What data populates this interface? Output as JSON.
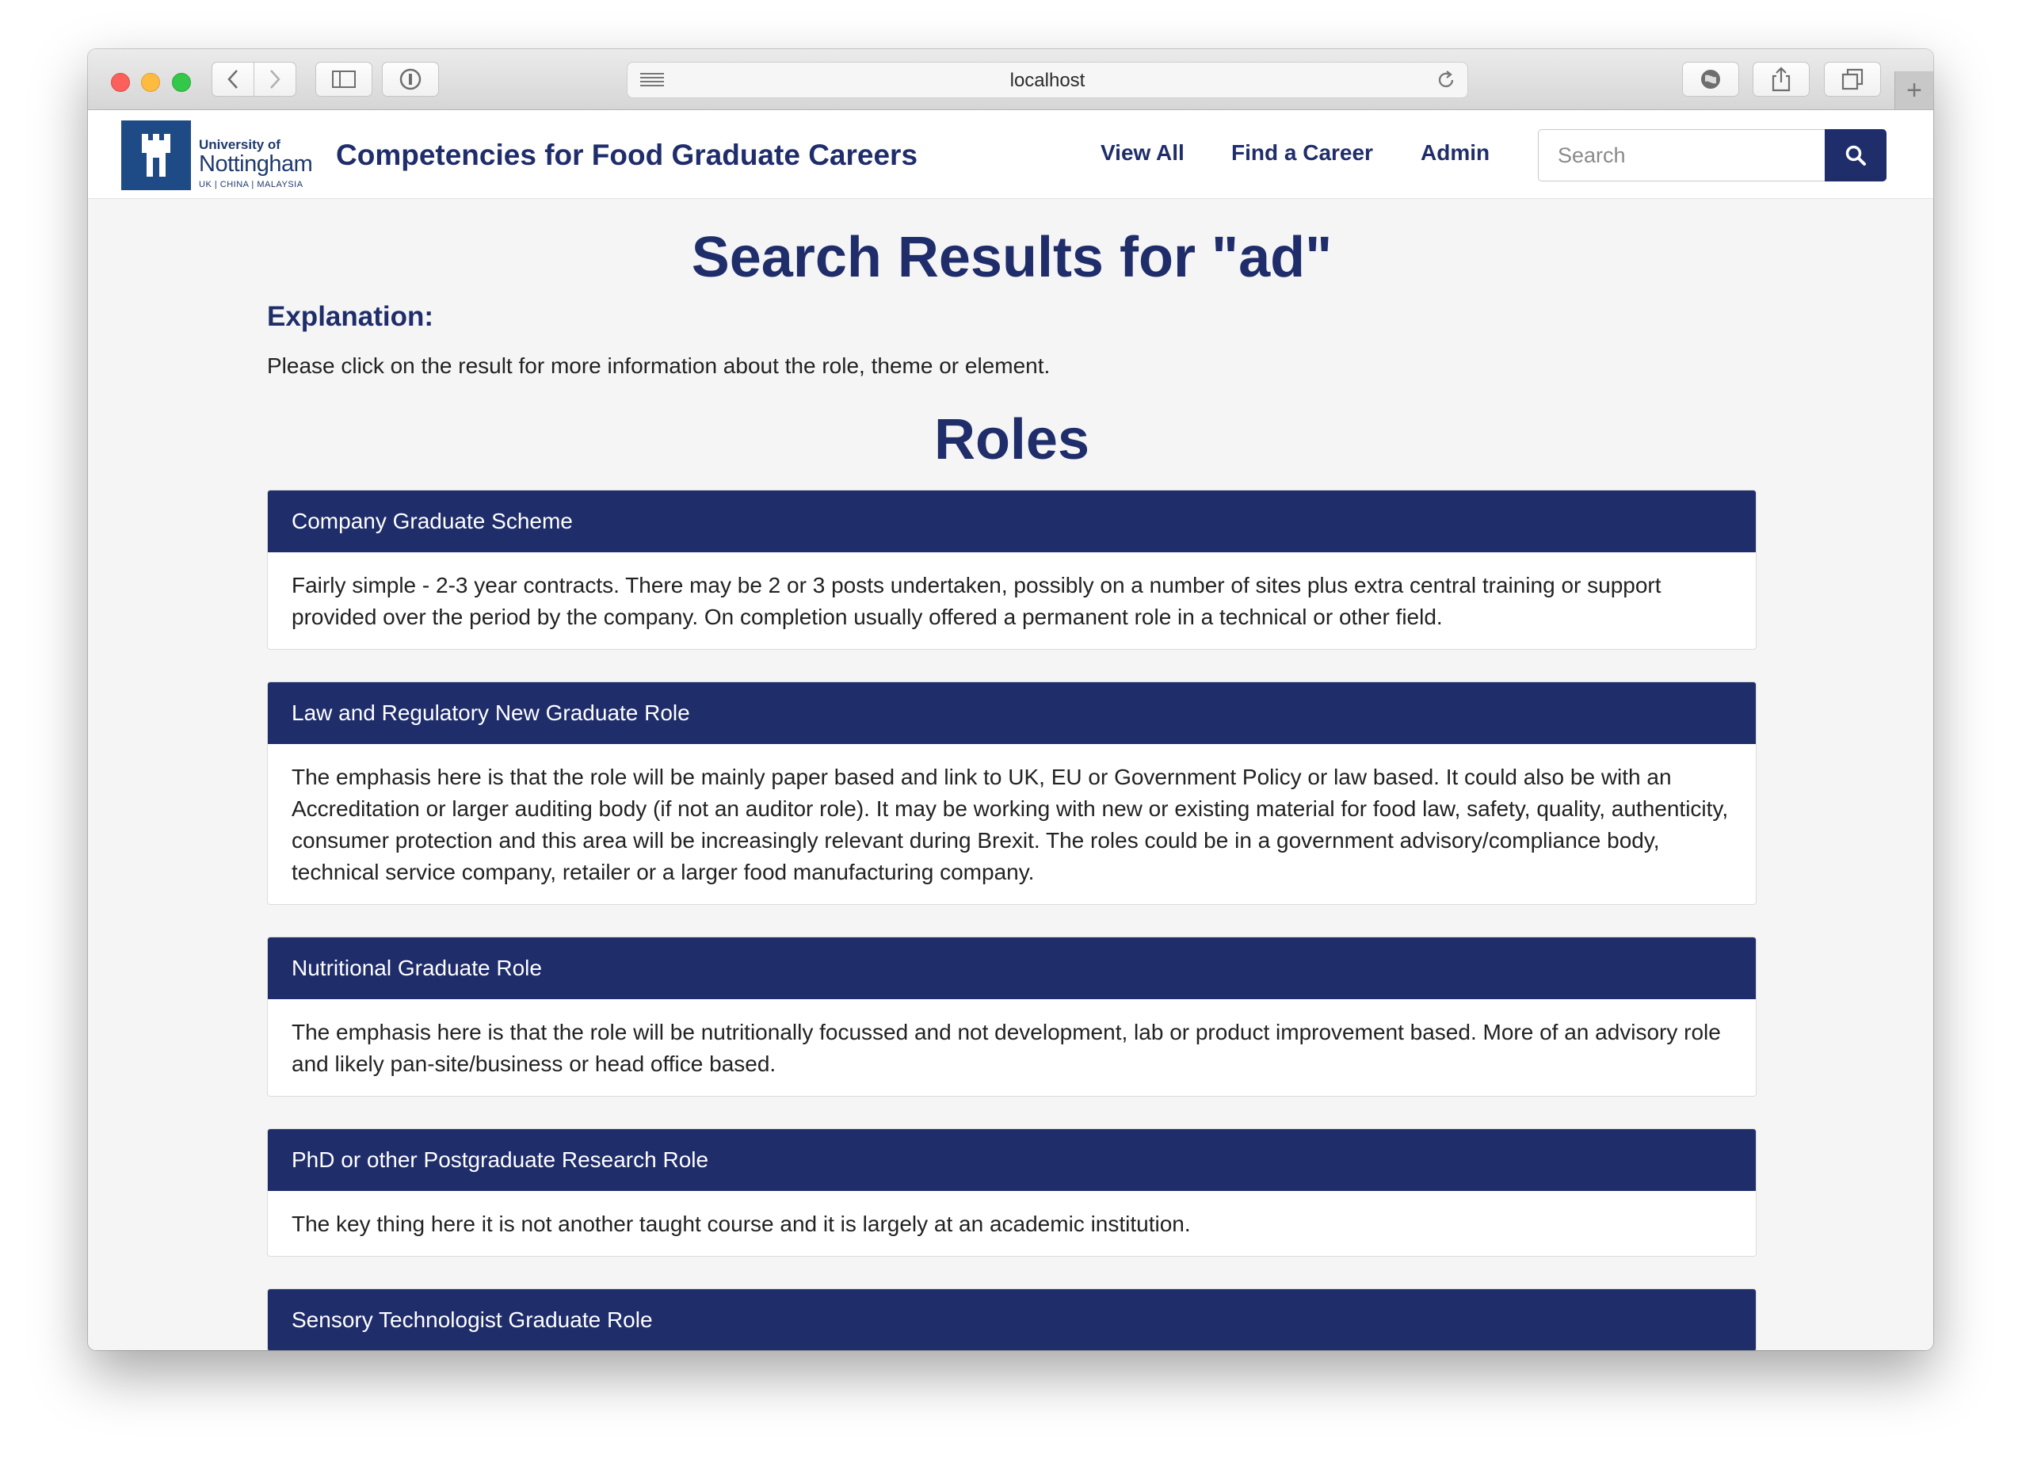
{
  "browser": {
    "url": "localhost"
  },
  "logo": {
    "line1": "University of",
    "line2": "Nottingham",
    "line3": "UK | CHINA | MALAYSIA"
  },
  "nav": {
    "brand": "Competencies for Food Graduate Careers",
    "links": [
      "View All",
      "Find a Career",
      "Admin"
    ],
    "search_placeholder": "Search"
  },
  "main": {
    "title": "Search Results for \"ad\"",
    "explanation_heading": "Explanation:",
    "explanation_text": "Please click on the result for more information about the role, theme or element.",
    "section_title": "Roles",
    "roles": [
      {
        "title": "Company Graduate Scheme",
        "description": "Fairly simple - 2-3 year contracts. There may be 2 or 3 posts undertaken, possibly on a number of sites plus extra central training or support provided over the period by the company. On completion usually offered a permanent role in a technical or other field."
      },
      {
        "title": "Law and Regulatory New Graduate Role",
        "description": "The emphasis here is that the role will be mainly paper based and link to UK, EU or Government Policy or law based. It could also be with an Accreditation or larger auditing body (if not an auditor role). It may be working with new or existing material for food law, safety, quality, authenticity, consumer protection and this area will be increasingly relevant during Brexit. The roles could be in a government advisory/compliance body, technical service company, retailer or a larger food manufacturing company."
      },
      {
        "title": "Nutritional Graduate Role",
        "description": "The emphasis here is that the role will be nutritionally focussed and not development, lab or product improvement based. More of an advisory role and likely pan-site/business or head office based."
      },
      {
        "title": "PhD or other Postgraduate Research Role",
        "description": "The key thing here it is not another taught course and it is largely at an academic institution."
      },
      {
        "title": "Sensory Technologist Graduate Role",
        "description": ""
      }
    ]
  },
  "colors": {
    "brand_navy": "#1f2d6b",
    "logo_blue": "#1e4a86",
    "page_bg": "#f5f5f5"
  }
}
